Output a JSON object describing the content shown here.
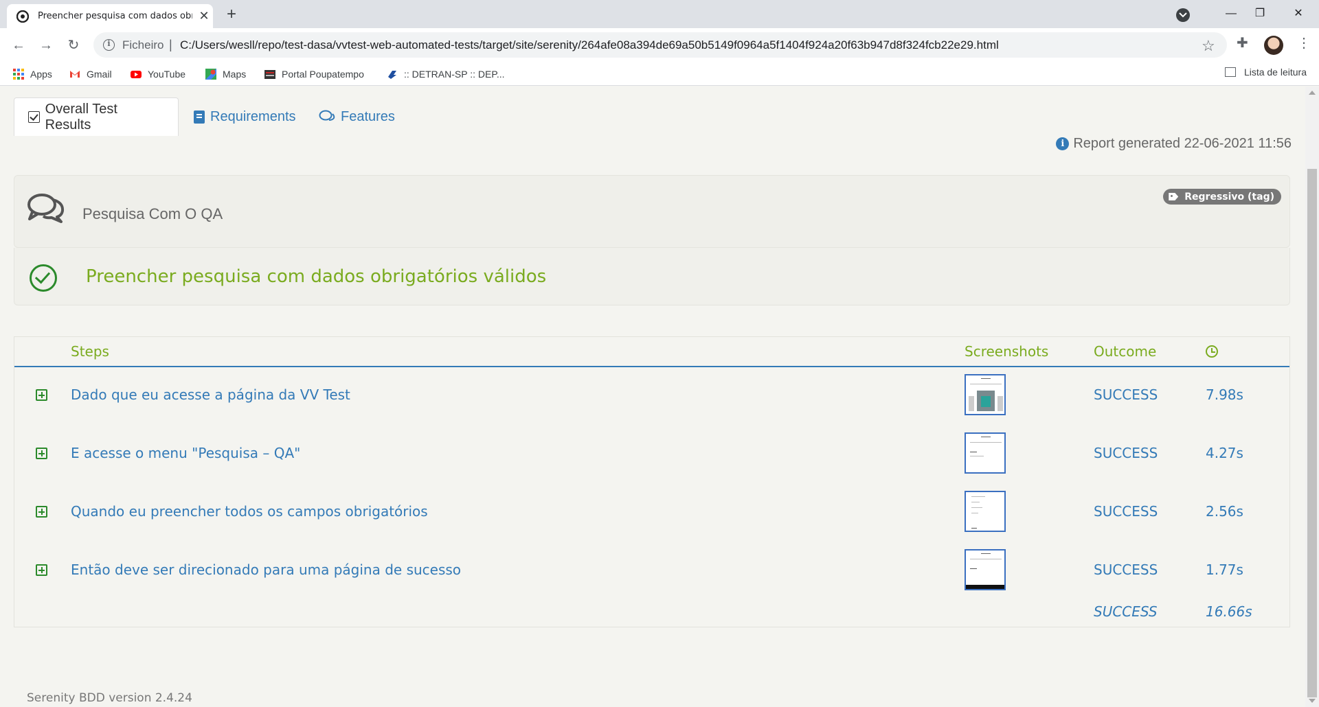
{
  "browser": {
    "tab_title": "Preencher pesquisa com dados obrigatórios válidos",
    "scheme_label": "Ficheiro",
    "url": "C:/Users/wesll/repo/test-dasa/vvtest-web-automated-tests/target/site/serenity/264afe08a394de69a50b5149f0964a5f1404f924a20f63b947d8f324fcb22e29.html",
    "bookmarks": [
      {
        "label": "Apps",
        "icon": "apps-grid-icon"
      },
      {
        "label": "Gmail",
        "icon": "gmail-icon"
      },
      {
        "label": "YouTube",
        "icon": "youtube-icon"
      },
      {
        "label": "Maps",
        "icon": "maps-icon"
      },
      {
        "label": "Portal Poupatempo",
        "icon": "poupatempo-icon"
      },
      {
        "label": ":: DETRAN-SP :: DEP...",
        "icon": "detran-icon"
      }
    ],
    "reading_list": "Lista de leitura"
  },
  "report": {
    "tabs": [
      {
        "label": "Overall Test Results",
        "icon": "checkbox-icon",
        "active": true
      },
      {
        "label": "Requirements",
        "icon": "book-icon",
        "active": false
      },
      {
        "label": "Features",
        "icon": "comments-icon",
        "active": false
      }
    ],
    "generated": "Report generated 22-06-2021 11:56",
    "feature_name": "Pesquisa Com O QA",
    "tag": "Regressivo (tag)",
    "scenario_title": "Preencher pesquisa com dados obrigatórios válidos",
    "columns": {
      "steps": "Steps",
      "screenshots": "Screenshots",
      "outcome": "Outcome",
      "duration_icon": "clock-icon"
    },
    "steps": [
      {
        "description": "Dado que eu acesse a página da VV Test",
        "outcome": "SUCCESS",
        "duration": "7.98s"
      },
      {
        "description": "E acesse o menu \"Pesquisa – QA\"",
        "outcome": "SUCCESS",
        "duration": "4.27s"
      },
      {
        "description": "Quando eu preencher todos os campos obrigatórios",
        "outcome": "SUCCESS",
        "duration": "2.56s"
      },
      {
        "description": "Então deve ser direcionado para uma página de sucesso",
        "outcome": "SUCCESS",
        "duration": "1.77s"
      }
    ],
    "total_outcome": "SUCCESS",
    "total_duration": "16.66s",
    "footer": "Serenity BDD version 2.4.24"
  },
  "colors": {
    "link_blue": "#337ab7",
    "success_green": "#2b8a2b",
    "header_green": "#7aab1f"
  }
}
